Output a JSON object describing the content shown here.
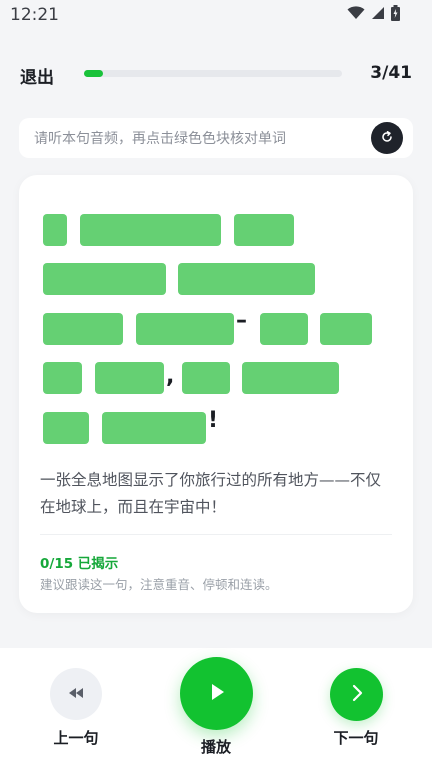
{
  "status_bar": {
    "time": "12:21"
  },
  "header": {
    "exit_label": "退出",
    "progress_fraction": 0.073,
    "progress_text": "3/41"
  },
  "hint": {
    "text": "请听本句音频，再点击绿色色块核对单词"
  },
  "sentence": {
    "hidden_word_count": 15,
    "punctuation": [
      "–",
      ",",
      "!"
    ]
  },
  "translation": "一张全息地图显示了你旅行过的所有地方——不仅在地球上，而且在宇宙中！",
  "reveal": {
    "count_text": "0/15 已揭示",
    "advice": "建议跟读这一句，注意重音、停顿和连读。"
  },
  "controls": {
    "prev_label": "上一句",
    "play_label": "播放",
    "next_label": "下一句"
  },
  "colors": {
    "accent": "#12c230",
    "word_block": "#65d073",
    "reveal_text": "#16a83a"
  }
}
